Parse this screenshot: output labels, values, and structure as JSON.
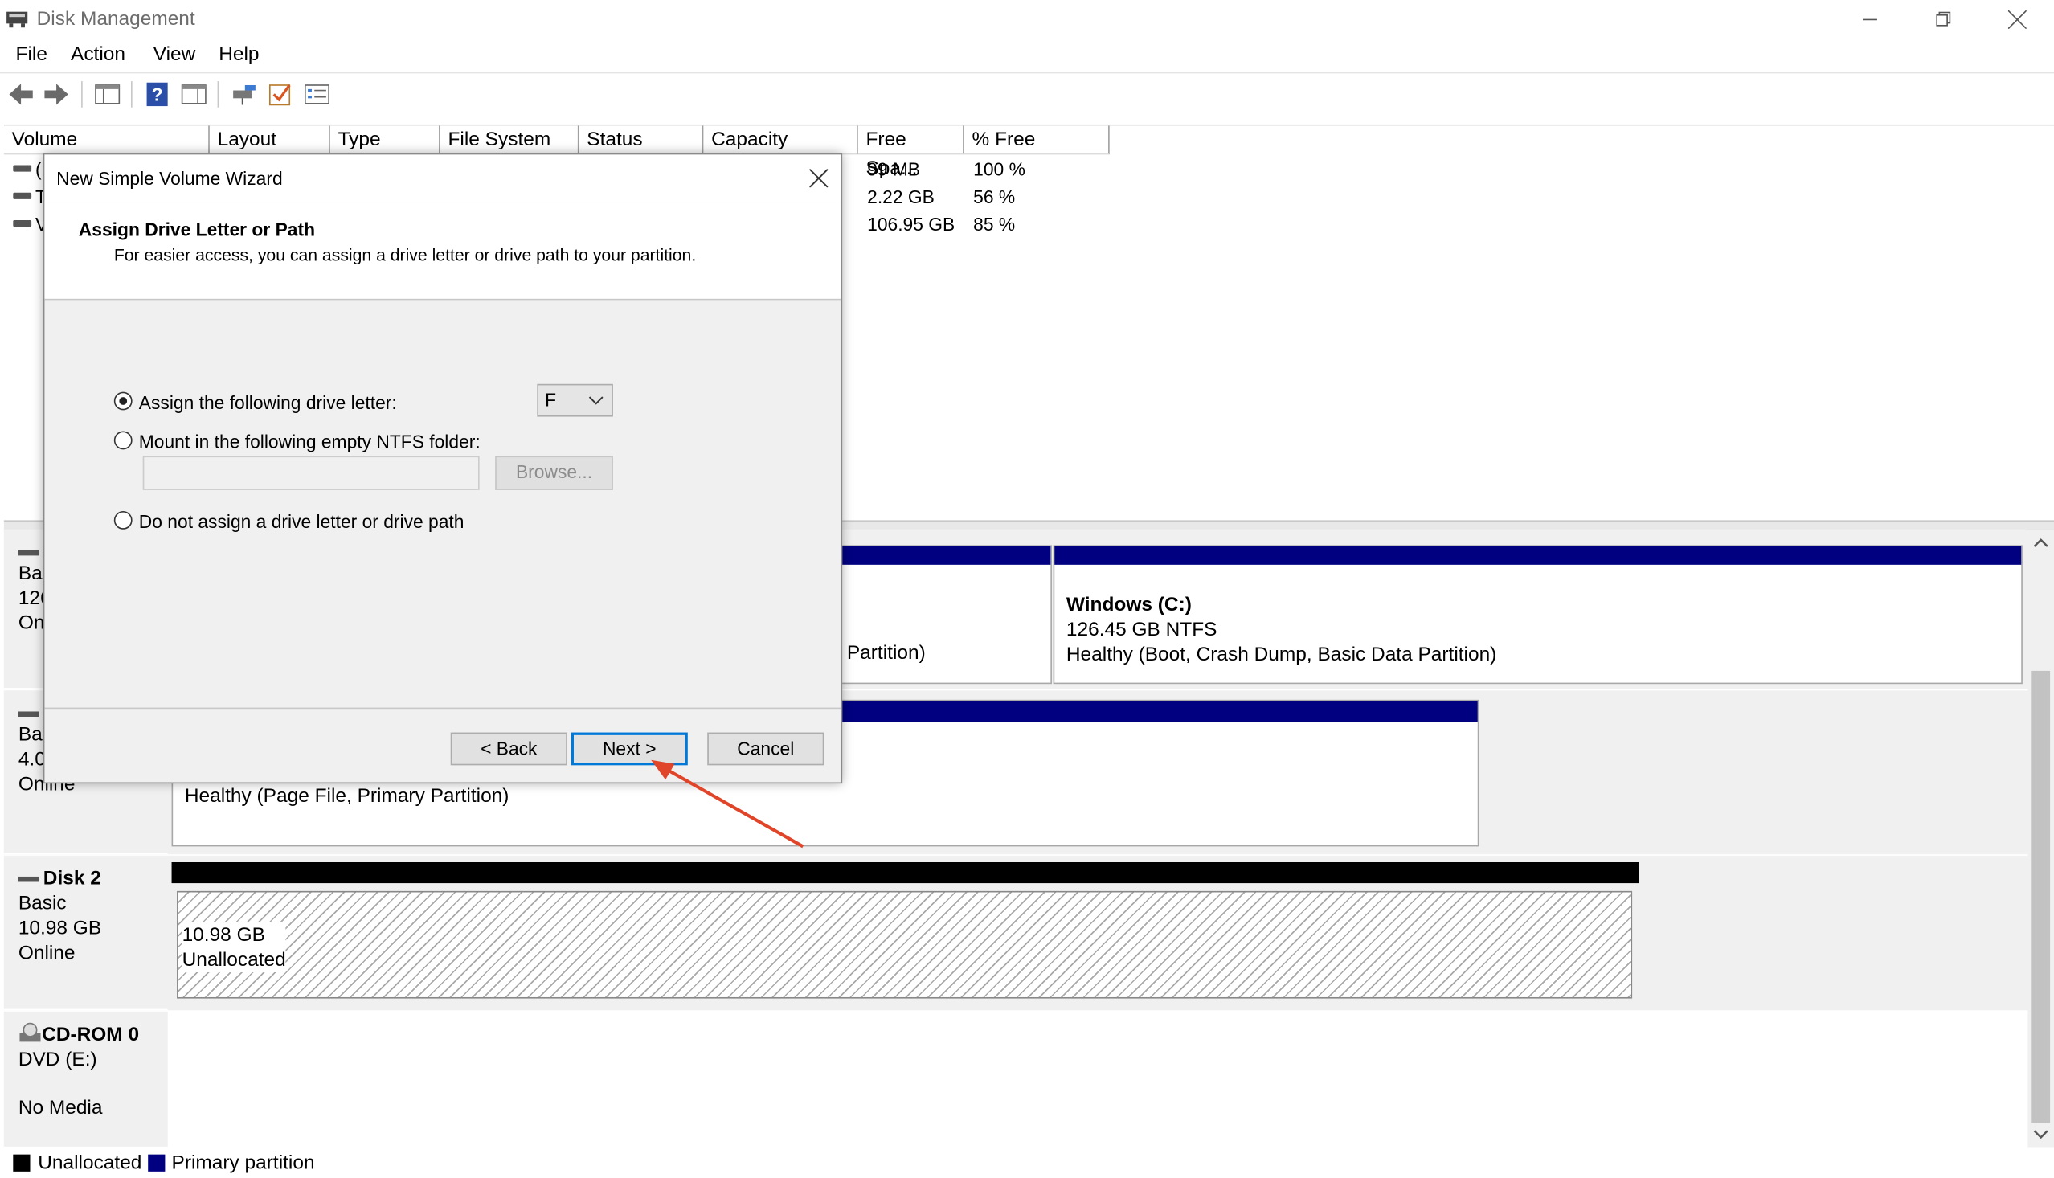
{
  "window": {
    "title": "Disk Management"
  },
  "menu": [
    "File",
    "Action",
    "View",
    "Help"
  ],
  "toolbar": {
    "icons": [
      "back-arrow-icon",
      "forward-arrow-icon",
      "console-tree-icon",
      "help-icon",
      "properties-icon",
      "connect-disk-icon",
      "check-icon",
      "list-view-icon"
    ]
  },
  "volume_table": {
    "columns": [
      "Volume",
      "Layout",
      "Type",
      "File System",
      "Status",
      "Capacity",
      "Free Spa...",
      "% Free"
    ],
    "rows": [
      {
        "volume": "(",
        "free": "99 MB",
        "pct": "100 %"
      },
      {
        "volume": "T",
        "free": "2.22 GB",
        "pct": "56 %"
      },
      {
        "volume": "V",
        "free": "106.95 GB",
        "pct": "85 %"
      }
    ]
  },
  "disks": {
    "disk0": {
      "type": "Bas",
      "size": "126",
      "status": "On",
      "part_left_text": "n Partition)",
      "part_c_name": "Windows  (C:)",
      "part_c_size": "126.45 GB NTFS",
      "part_c_status": "Healthy (Boot, Crash Dump, Basic Data Partition)"
    },
    "disk1": {
      "type": "Bas",
      "size": "4.0",
      "status": "Online",
      "part_status": "Healthy (Page File, Primary Partition)"
    },
    "disk2": {
      "name": "Disk 2",
      "type": "Basic",
      "size": "10.98 GB",
      "status": "Online",
      "part_size": "10.98 GB",
      "part_status": "Unallocated"
    },
    "cdrom": {
      "name": "CD-ROM 0",
      "drive": "DVD (E:)",
      "status": "No Media"
    }
  },
  "legend": {
    "unallocated": "Unallocated",
    "primary": "Primary partition"
  },
  "colors": {
    "primary": "#000080",
    "unallocated": "#000000",
    "highlight": "#0078d7",
    "arrow": "#e0452a"
  },
  "wizard": {
    "title": "New Simple Volume Wizard",
    "heading": "Assign Drive Letter or Path",
    "subheading": "For easier access, you can assign a drive letter or drive path to your partition.",
    "option_assign": "Assign the following drive letter:",
    "drive_letter": "F",
    "option_mount": "Mount in the following empty NTFS folder:",
    "browse": "Browse...",
    "option_none": "Do not assign a drive letter or drive path",
    "back": "< Back",
    "next": "Next >",
    "cancel": "Cancel"
  }
}
